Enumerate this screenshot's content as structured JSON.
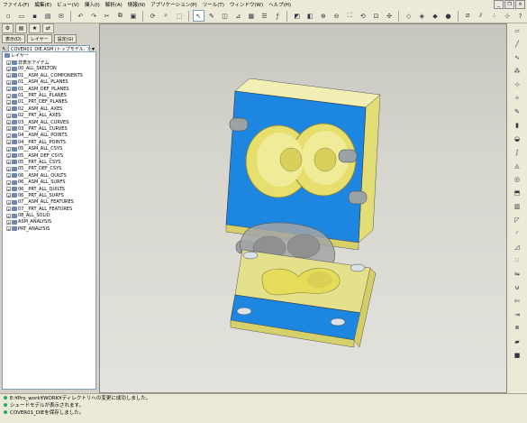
{
  "menu": [
    "ファイル(F)",
    "編集(E)",
    "ビュー(V)",
    "挿入(I)",
    "解析(A)",
    "情報(N)",
    "アプリケーション(P)",
    "ツール(T)",
    "ウィンドウ(W)",
    "ヘルプ(H)"
  ],
  "left_panel": {
    "tabs": [
      "表示(D)",
      "レイヤー",
      "設定(G)"
    ],
    "model_combo": "COVER01_DIE.ASM (トップモデル, アクテ...",
    "tree": [
      "レイヤー",
      "非表示アイテム",
      "00_ALL_SKELTON",
      "01__ASM_ALL_COMPONENTS",
      "01__ASM_ALL_PLANES",
      "01__ASM_DEF_PLANES",
      "01__PRT_ALL_PLANES",
      "01__PRT_DEF_PLANES",
      "02__ASM_ALL_AXES",
      "02__PRT_ALL_AXES",
      "03__ASM_ALL_CURVES",
      "03__PRT_ALL_CURVES",
      "04__ASM_ALL_POINTS",
      "04__PRT_ALL_POINTS",
      "05__ASM_ALL_CSYS",
      "05__ASM_DEF_CSYS",
      "05__PRT_ALL_CSYS",
      "05__PRT_DEF_CSYS",
      "06__ASM_ALL_QUILTS",
      "06__ASM_ALL_SURFS",
      "06__PRT_ALL_QUILTS",
      "06__PRT_ALL_SURFS",
      "07__ASM_ALL_FEATURES",
      "07__PRT_ALL_FEATURES",
      "08_ALL_SOLID",
      "ASM_ANALYSIS",
      "PRT_ANALYSIS"
    ]
  },
  "status": [
    "E:¥Pro_work¥WORK¥ディレクトリへの変更に成功しました。",
    "シェードモデルが表示されます。",
    "COVER01_DIEを保存しました。"
  ],
  "colors": {
    "mold_blue": "#1d86e0",
    "mold_yellow": "#e8e48a",
    "part_yellow": "#e4dc6e",
    "viewport_bg": "#d3d2cb"
  }
}
